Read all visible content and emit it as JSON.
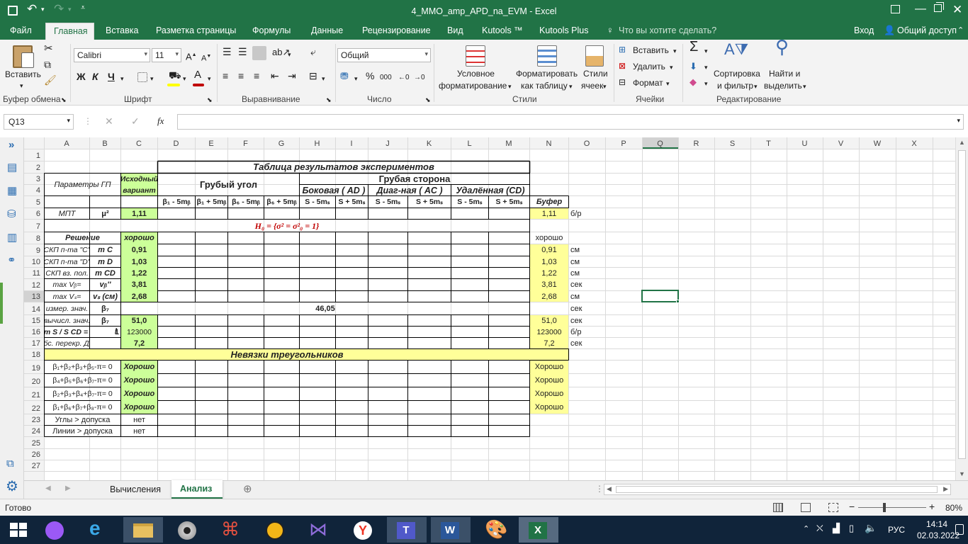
{
  "window": {
    "title": "4_MMO_amp_APD_na_EVM  -  Excel",
    "colors": {
      "accent": "#217346",
      "highlight": "#ffff99",
      "cellGreen": "#ccff99",
      "red": "#c00000"
    }
  },
  "tabs": [
    "Файл",
    "Главная",
    "Вставка",
    "Разметка страницы",
    "Формулы",
    "Данные",
    "Рецензирование",
    "Вид",
    "Kutools ™",
    "Kutools Plus"
  ],
  "tell_me": "Что вы хотите сделать?",
  "account": {
    "login": "Вход",
    "share": "Общий доступ"
  },
  "ribbon": {
    "clipboard": {
      "paste": "Вставить",
      "label": "Буфер обмена"
    },
    "font": {
      "name": "Calibri",
      "size": "11",
      "bold": "Ж",
      "italic": "К",
      "underline": "Ч",
      "label": "Шрифт"
    },
    "alignment": {
      "label": "Выравнивание"
    },
    "number": {
      "format": "Общий",
      "percent": "%",
      "thousands": "000",
      "label": "Число"
    },
    "styles": {
      "cond1": "Условное",
      "cond2": "форматирование",
      "table1": "Форматировать",
      "table2": "как таблицу",
      "cell1": "Стили",
      "cell2": "ячеек",
      "label": "Стили"
    },
    "cells": {
      "insert": "Вставить",
      "delete": "Удалить",
      "format": "Формат",
      "label": "Ячейки"
    },
    "editing": {
      "sort1": "Сортировка",
      "sort2": "и фильтр",
      "find1": "Найти и",
      "find2": "выделить",
      "label": "Редактирование"
    }
  },
  "formula_bar": {
    "name_box": "Q13",
    "fx": "fx",
    "formula": ""
  },
  "columns": [
    "A",
    "B",
    "C",
    "D",
    "E",
    "F",
    "G",
    "H",
    "I",
    "J",
    "K",
    "L",
    "M",
    "N",
    "O",
    "P",
    "Q",
    "R",
    "S",
    "T",
    "U",
    "V",
    "W",
    "X"
  ],
  "rows": [
    "1",
    "2",
    "3",
    "4",
    "5",
    "6",
    "7",
    "8",
    "9",
    "10",
    "11",
    "12",
    "13",
    "14",
    "15",
    "16",
    "17",
    "18",
    "19",
    "20",
    "21",
    "22",
    "23",
    "24",
    "25",
    "26",
    "27"
  ],
  "sheet": {
    "title": "Таблица результатов экспериментов",
    "params_header": "Параметры ГП",
    "initial_variant_1": "Исходный",
    "initial_variant_2": "вариант",
    "rough_angle": "Грубый угол",
    "rough_side": "Грубая сторона",
    "side_lateral": "Боковая  ( AD  )",
    "side_diag": "Диаг-ная  (  AC )",
    "side_remote": "Удалённая  (CD)",
    "angle_cols": [
      "β₁ - 5mᵦ",
      "β₁ + 5mᵦ",
      "β₆ - 5mᵦ",
      "β₆ + 5mᵦ"
    ],
    "side_cols": [
      "S - 5mₛ",
      "S + 5mₛ",
      "S - 5mₛ",
      "S + 5mₛ",
      "S - 5mₛ",
      "S + 5mₛ"
    ],
    "buffer": "Буфер",
    "mpt_label": "МПТ",
    "mu2": "μ²",
    "mpt_value": "1,11",
    "mpt_buffer": "1,11",
    "mpt_unit": "б/р",
    "hypothesis": "H₀ = {σ² = σ²₀ = 1}",
    "solution": "Решение",
    "solution_value": "хорошо",
    "solution_buffer": "хорошо",
    "rows": [
      {
        "label": "СКП п-та \"C\"",
        "sym": "m C",
        "val": "0,91",
        "buf": "0,91",
        "unit": "см"
      },
      {
        "label": "СКП п-та \"D\"",
        "sym": "m D",
        "val": "1,03",
        "buf": "1,03",
        "unit": "см"
      },
      {
        "label": "СКП вз. пол.",
        "sym": "m CD",
        "val": "1,22",
        "buf": "1,22",
        "unit": "см"
      },
      {
        "label": "max Vᵦ=",
        "sym": "vᵦ''",
        "val": "3,81",
        "buf": "3,81",
        "unit": "сек"
      },
      {
        "label": "max Vₛ=",
        "sym": "vₛ (см)",
        "val": "2,68",
        "buf": "2,68",
        "unit": "см"
      }
    ],
    "measured_label": "измер. знач.",
    "measured_sym": "β₇",
    "measured_value": "46,05",
    "measured_unit": "сек",
    "computed_label": "вычисл. знач.",
    "computed_sym": "β₇",
    "computed_value": "51,0",
    "computed_buf": "51,0",
    "computed_unit": "сек",
    "ratio_label": "m S / S CD =",
    "ratio_one": "1",
    "ratio_slash": "/",
    "ratio_value": "123000",
    "ratio_buf": "123000",
    "ratio_unit": "б/р",
    "abs_label": "абс. перекр. ДИ",
    "abs_value": "7,2",
    "abs_buf": "7,2",
    "abs_unit": "сек",
    "misclosure_title": "Невязки треугольников",
    "misclosures": [
      {
        "formula": "β₁+β₂+β₃+β₅-π= 0",
        "val": "Хорошо",
        "buf": "Хорошо"
      },
      {
        "formula": "β₄+β₅+β₆+β₇-π= 0",
        "val": "Хорошо",
        "buf": "Хорошо"
      },
      {
        "formula": "β₂+β₃+β₄+β₇-π= 0",
        "val": "Хорошо",
        "buf": "Хорошо"
      },
      {
        "formula": "β₁+β₆+β₇+β₈-π= 0",
        "val": "Хорошо",
        "buf": "Хорошо"
      }
    ],
    "angles_check": "Углы > допуска",
    "angles_value": "нет",
    "lines_check": "Линии > допуска",
    "lines_value": "нет"
  },
  "sheet_tabs": [
    "Вычисления",
    "Анализ"
  ],
  "status": {
    "ready": "Готово",
    "zoom": "80%"
  },
  "taskbar": {
    "lang": "РУС",
    "time": "14:14",
    "date": "02.03.2022"
  }
}
